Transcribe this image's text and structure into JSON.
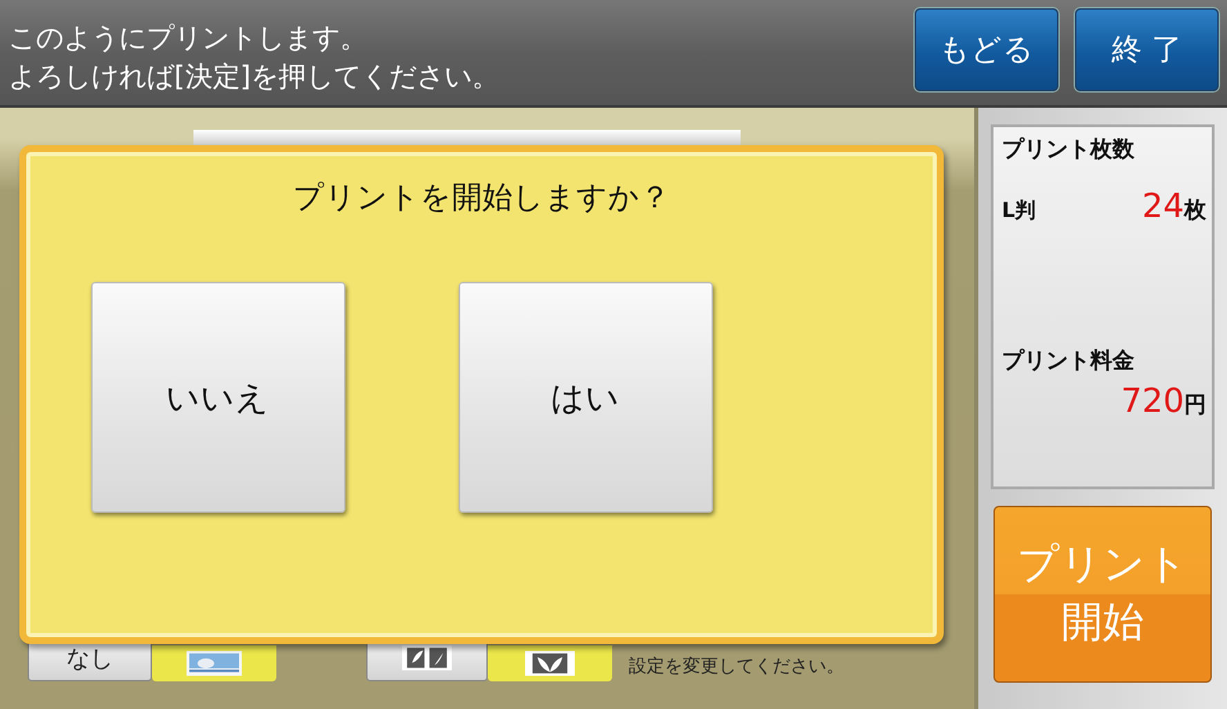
{
  "header": {
    "message_lines": [
      "このようにプリントします。",
      "よろしければ[決定]を押してください。"
    ],
    "buttons": [
      {
        "label": "もどる"
      },
      {
        "label": "終 了"
      }
    ]
  },
  "background": {
    "none_button": "なし",
    "note": "設定を変更してください。"
  },
  "summary": {
    "count_title": "プリント枚数",
    "size_label": "L判",
    "count_value": "24",
    "count_unit": "枚",
    "price_title": "プリント料金",
    "price_value": "720",
    "price_unit": "円"
  },
  "start_button": {
    "lines": [
      "プリント",
      "開始"
    ]
  },
  "dialog": {
    "question": "プリントを開始しますか？",
    "buttons": [
      {
        "label": "いいえ"
      },
      {
        "label": "はい"
      }
    ]
  }
}
